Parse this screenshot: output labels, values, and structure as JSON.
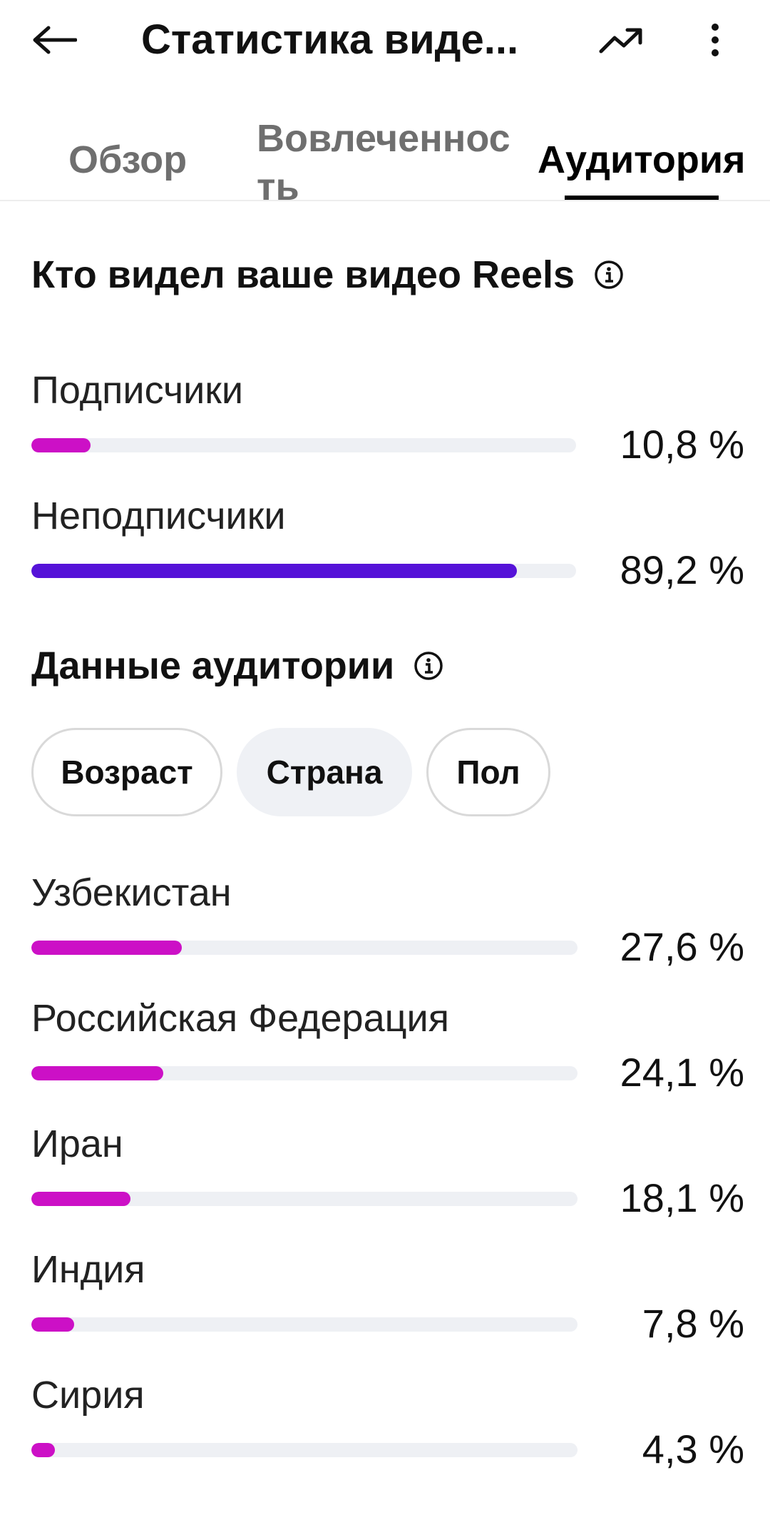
{
  "header": {
    "title": "Статистика виде...",
    "icons": {
      "back": "arrow-left-icon",
      "trend": "trending-up-icon",
      "more": "more-vertical-icon"
    }
  },
  "tabs": [
    {
      "label": "Обзор",
      "active": false
    },
    {
      "label": "Вовлеченность",
      "active": false
    },
    {
      "label": "Аудитория",
      "active": true
    }
  ],
  "reels_section": {
    "title": "Кто видел ваше видео Reels",
    "items": [
      {
        "label": "Подписчики",
        "value": "10,8 %",
        "fraction": 0.108,
        "color": "#cc10c6"
      },
      {
        "label": "Неподписчики",
        "value": "89,2 %",
        "fraction": 0.892,
        "color": "#5512d8"
      }
    ]
  },
  "audience_section": {
    "title": "Данные аудитории",
    "chips": [
      {
        "label": "Возраст",
        "selected": false
      },
      {
        "label": "Страна",
        "selected": true
      },
      {
        "label": "Пол",
        "selected": false
      }
    ],
    "countries": [
      {
        "label": "Узбекистан",
        "value": "27,6 %",
        "fraction": 0.276
      },
      {
        "label": "Российская Федерация",
        "value": "24,1 %",
        "fraction": 0.241
      },
      {
        "label": "Иран",
        "value": "18,1 %",
        "fraction": 0.181
      },
      {
        "label": "Индия",
        "value": "7,8 %",
        "fraction": 0.078
      },
      {
        "label": "Сирия",
        "value": "4,3 %",
        "fraction": 0.043
      }
    ],
    "bar_color": "#cc10c6"
  },
  "colors": {
    "track": "#eef0f4",
    "accent_magenta": "#cc10c6",
    "accent_purple": "#5512d8"
  }
}
